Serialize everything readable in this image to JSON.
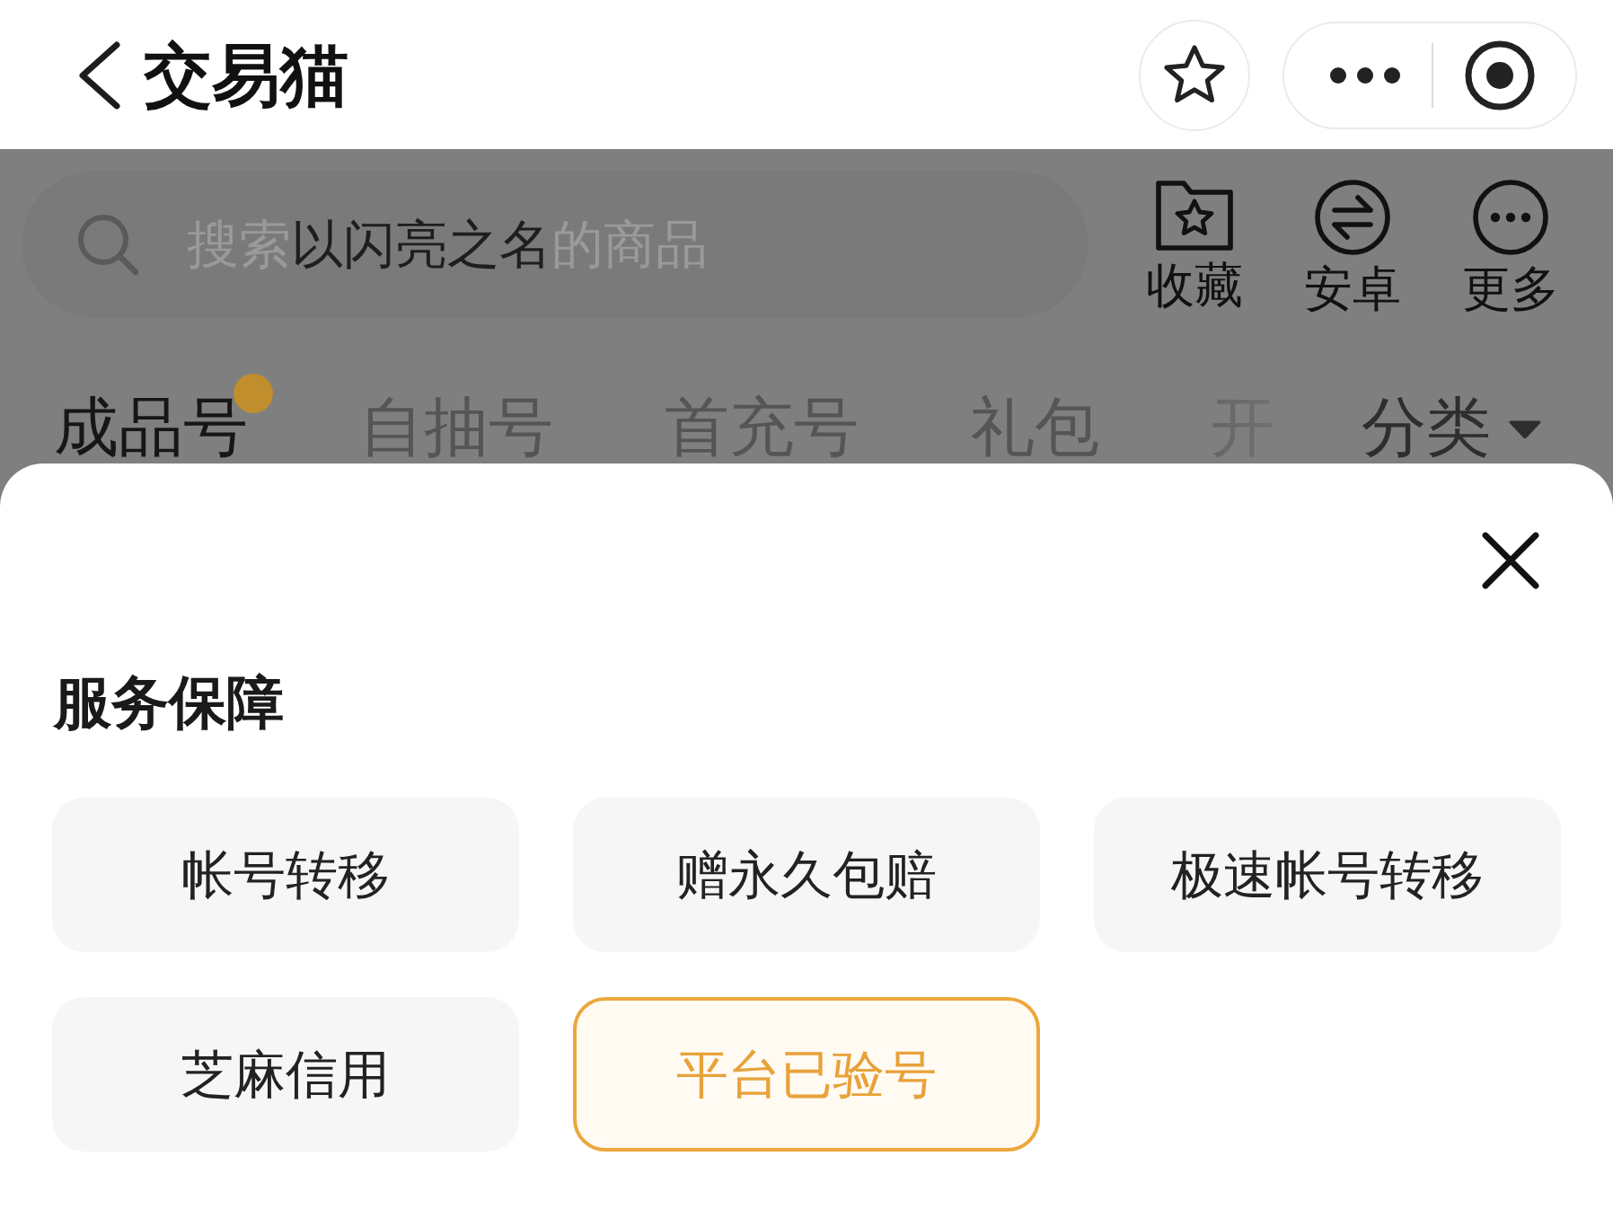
{
  "header": {
    "title": "交易猫"
  },
  "search": {
    "placeholder_parts": [
      {
        "text": "搜索",
        "highlight": false
      },
      {
        "text": "以闪亮之名",
        "highlight": true
      },
      {
        "text": "的商品",
        "highlight": false
      }
    ]
  },
  "shortcuts": [
    {
      "kind": "favorite",
      "label": "收藏"
    },
    {
      "kind": "android",
      "label": "安卓"
    },
    {
      "kind": "more",
      "label": "更多"
    }
  ],
  "tabs": [
    {
      "label": "成品号",
      "selected": true,
      "dot": true
    },
    {
      "label": "自抽号",
      "selected": false,
      "dot": false
    },
    {
      "label": "首充号",
      "selected": false,
      "dot": false
    },
    {
      "label": "礼包",
      "selected": false,
      "dot": false
    },
    {
      "label": "开",
      "selected": false,
      "dot": false
    }
  ],
  "category_filter": {
    "label": "分类"
  },
  "sheet": {
    "title": "服务保障",
    "options": [
      {
        "label": "帐号转移",
        "selected": false
      },
      {
        "label": "赠永久包赔",
        "selected": false
      },
      {
        "label": "极速帐号转移",
        "selected": false
      },
      {
        "label": "芝麻信用",
        "selected": false
      },
      {
        "label": "平台已验号",
        "selected": true
      }
    ]
  }
}
